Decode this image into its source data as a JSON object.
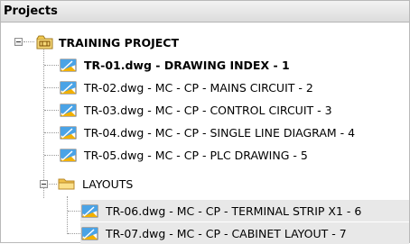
{
  "panel": {
    "title": "Projects"
  },
  "tree": {
    "project": {
      "label": "TRAINING PROJECT",
      "icon": "project-icon"
    },
    "drawings": [
      {
        "label": "TR-01.dwg - DRAWING INDEX - 1",
        "bold": true,
        "icon": "drawing-icon"
      },
      {
        "label": "TR-02.dwg - MC - CP - MAINS CIRCUIT - 2",
        "icon": "drawing-icon"
      },
      {
        "label": "TR-03.dwg - MC - CP - CONTROL CIRCUIT - 3",
        "icon": "drawing-icon"
      },
      {
        "label": "TR-04.dwg - MC - CP - SINGLE LINE DIAGRAM - 4",
        "icon": "drawing-icon"
      },
      {
        "label": "TR-05.dwg - MC - CP - PLC DRAWING - 5",
        "icon": "drawing-icon"
      }
    ],
    "folder": {
      "label": "LAYOUTS",
      "icon": "folder-icon"
    },
    "layouts": [
      {
        "label": "TR-06.dwg - MC - CP - TERMINAL STRIP X1 - 6",
        "icon": "drawing-icon"
      },
      {
        "label": "TR-07.dwg - MC - CP - CABINET LAYOUT - 7",
        "icon": "drawing-icon"
      }
    ]
  }
}
